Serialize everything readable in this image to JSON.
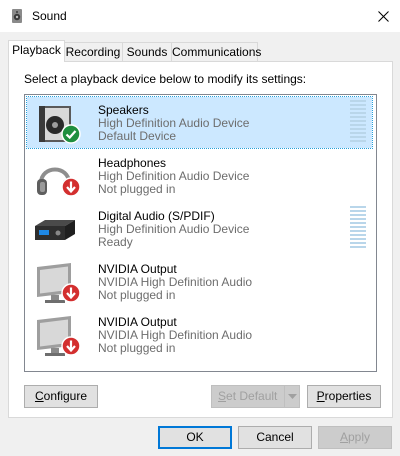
{
  "window": {
    "title": "Sound",
    "close_icon": "close-icon",
    "app_icon": "speaker-icon"
  },
  "tabs": [
    {
      "label": "Playback",
      "active": true
    },
    {
      "label": "Recording",
      "active": false
    },
    {
      "label": "Sounds",
      "active": false
    },
    {
      "label": "Communications",
      "active": false
    }
  ],
  "instruction": "Select a playback device below to modify its settings:",
  "devices": [
    {
      "name": "Speakers",
      "description": "High Definition Audio Device",
      "status": "Default Device",
      "icon": "speakers-icon",
      "badge": "default-check-icon",
      "selected": true,
      "level_meter": true
    },
    {
      "name": "Headphones",
      "description": "High Definition Audio Device",
      "status": "Not plugged in",
      "icon": "headphones-icon",
      "badge": "unplugged-arrow-icon",
      "selected": false,
      "level_meter": false
    },
    {
      "name": "Digital Audio (S/PDIF)",
      "description": "High Definition Audio Device",
      "status": "Ready",
      "icon": "digital-audio-icon",
      "badge": "",
      "selected": false,
      "level_meter": true
    },
    {
      "name": "NVIDIA Output",
      "description": "NVIDIA High Definition Audio",
      "status": "Not plugged in",
      "icon": "monitor-icon",
      "badge": "unplugged-arrow-icon",
      "selected": false,
      "level_meter": false
    },
    {
      "name": "NVIDIA Output",
      "description": "NVIDIA High Definition Audio",
      "status": "Not plugged in",
      "icon": "monitor-icon",
      "badge": "unplugged-arrow-icon",
      "selected": false,
      "level_meter": false
    }
  ],
  "panel_buttons": {
    "configure": {
      "label_underlined": "C",
      "label_rest": "onfigure"
    },
    "set_default": {
      "label_underlined": "S",
      "label_rest": "et Default",
      "enabled": false
    },
    "properties": {
      "label_underlined": "P",
      "label_rest": "roperties"
    }
  },
  "dialog_buttons": {
    "ok": "OK",
    "cancel": "Cancel",
    "apply": {
      "label_underlined": "A",
      "label_rest": "pply",
      "enabled": false
    }
  },
  "colors": {
    "selection": "#cce8ff",
    "accent": "#0078d7",
    "check_green": "#1e8e3e",
    "unplugged_red": "#d32f2f"
  }
}
